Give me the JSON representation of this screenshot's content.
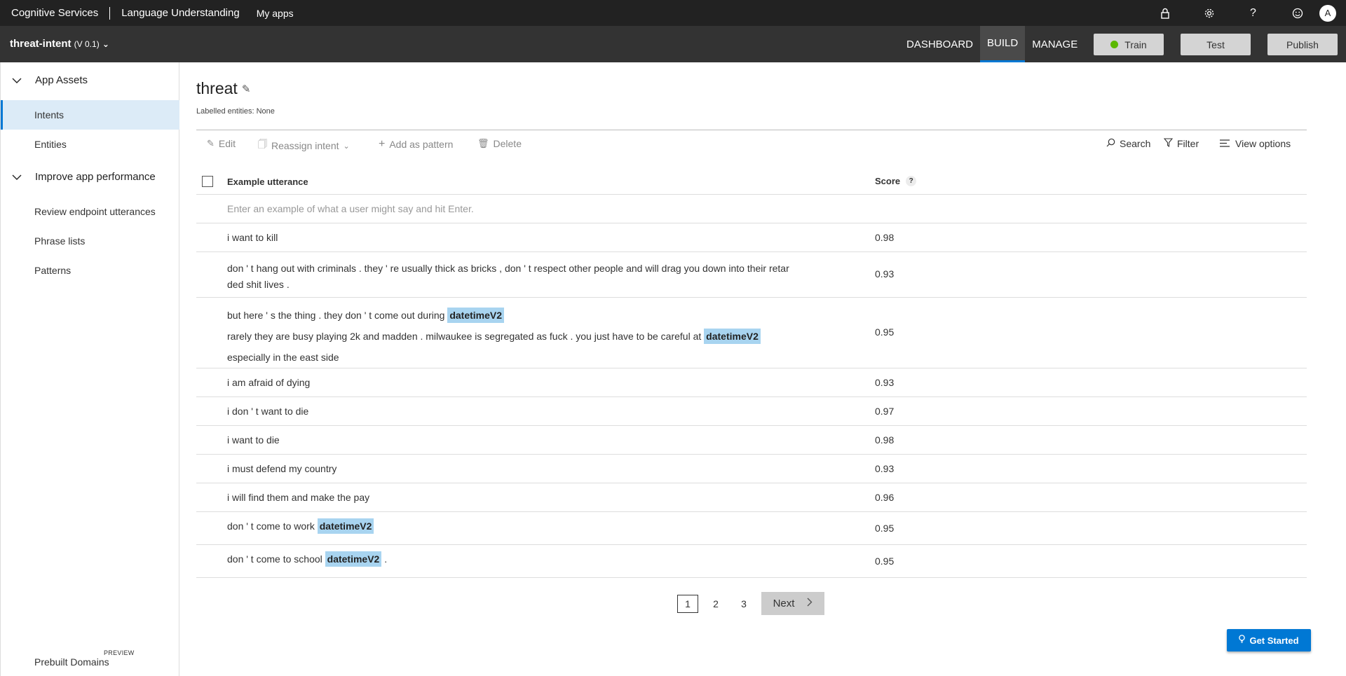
{
  "topbar": {
    "brand": "Cognitive Services",
    "product": "Language Understanding",
    "my_apps": "My apps",
    "icons": [
      "lock-icon",
      "gear-icon",
      "help-icon",
      "smiley-icon"
    ],
    "avatar": "A"
  },
  "appbar": {
    "app_name": "threat-intent",
    "version": "(V 0.1)",
    "nav": [
      "DASHBOARD",
      "BUILD",
      "MANAGE"
    ],
    "active_nav": "BUILD",
    "train": "Train",
    "test": "Test",
    "publish": "Publish"
  },
  "sidebar": {
    "app_assets": "App Assets",
    "items_assets": [
      "Intents",
      "Entities"
    ],
    "improve": "Improve app performance",
    "items_improve": [
      "Review endpoint utterances",
      "Phrase lists",
      "Patterns"
    ],
    "prebuilt": "Prebuilt Domains",
    "preview": "PREVIEW"
  },
  "main": {
    "title": "threat",
    "labelled": "Labelled entities: None",
    "toolbar": {
      "edit": "Edit",
      "reassign": "Reassign intent",
      "add_pattern": "Add as pattern",
      "delete": "Delete",
      "search": "Search",
      "filter": "Filter",
      "view_options": "View options"
    },
    "table": {
      "col_utterance": "Example utterance",
      "col_score": "Score",
      "input_placeholder": "Enter an example of what a user might say and hit Enter.",
      "rows": [
        {
          "utt": "i want to kill",
          "score": "0.98"
        },
        {
          "line1": "don ' t hang out with criminals . they ' re usually thick as bricks , don ' t respect other people and will drag you down into their retar",
          "line2": "ded shit lives .",
          "score": "0.93"
        },
        {
          "l1a": "but here ' s the thing . they don ' t come out during",
          "ent": "datetimeV2",
          "l2a": "rarely they are busy playing 2k and madden . milwaukee is segregated as fuck . you just have to be careful at",
          "ent2": "datetimeV2",
          "l3": "especially in the east side",
          "score": "0.95"
        },
        {
          "utt": "i am afraid of dying",
          "score": "0.93"
        },
        {
          "utt": "i don ' t want to die",
          "score": "0.97"
        },
        {
          "utt": "i want to die",
          "score": "0.98"
        },
        {
          "utt": "i must defend my country",
          "score": "0.93"
        },
        {
          "utt": "i will find them and make the pay",
          "score": "0.96"
        },
        {
          "pre": "don ' t come to work",
          "ent": "datetimeV2",
          "score": "0.95"
        },
        {
          "pre": "don ' t come to school",
          "ent": "datetimeV2",
          "post": ".",
          "score": "0.95"
        }
      ]
    },
    "pager": {
      "pages": [
        "1",
        "2",
        "3"
      ],
      "current": "1",
      "next": "Next"
    },
    "get_started": "Get Started"
  },
  "colors": {
    "accent": "#0078d4",
    "train_dot": "#5cb800",
    "entity_bg": "#a8d4f0"
  }
}
